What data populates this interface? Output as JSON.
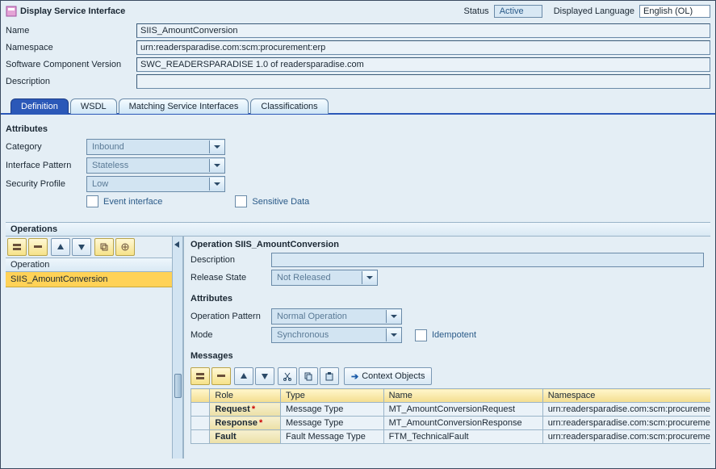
{
  "header": {
    "title": "Display Service Interface",
    "status_label": "Status",
    "status_value": "Active",
    "lang_label": "Displayed Language",
    "lang_value": "English (OL)"
  },
  "topfields": {
    "name_label": "Name",
    "name_value": "SIIS_AmountConversion",
    "namespace_label": "Namespace",
    "namespace_value": "urn:readersparadise.com:scm:procurement:erp",
    "swcv_label": "Software Component Version",
    "swcv_value": "SWC_READERSPARADISE 1.0 of readersparadise.com",
    "desc_label": "Description",
    "desc_value": ""
  },
  "tabs": {
    "definition": "Definition",
    "wsdl": "WSDL",
    "matching": "Matching Service Interfaces",
    "classifications": "Classifications"
  },
  "attributes": {
    "section": "Attributes",
    "category_label": "Category",
    "category_value": "Inbound",
    "pattern_label": "Interface Pattern",
    "pattern_value": "Stateless",
    "security_label": "Security Profile",
    "security_value": "Low",
    "event_interface": "Event interface",
    "sensitive_data": "Sensitive Data"
  },
  "operations": {
    "title": "Operations",
    "col_header": "Operation",
    "items": [
      "SIIS_AmountConversion"
    ]
  },
  "opdetail": {
    "title_prefix": "Operation ",
    "name": "SIIS_AmountConversion",
    "desc_label": "Description",
    "desc_value": "",
    "release_label": "Release State",
    "release_value": "Not Released",
    "attributes_section": "Attributes",
    "op_pattern_label": "Operation Pattern",
    "op_pattern_value": "Normal Operation",
    "mode_label": "Mode",
    "mode_value": "Synchronous",
    "idempotent_label": "Idempotent",
    "messages_section": "Messages",
    "context_objects": "Context Objects",
    "table": {
      "headers": {
        "role": "Role",
        "type": "Type",
        "name": "Name",
        "namespace": "Namespace"
      },
      "rows": [
        {
          "role": "Request",
          "star": true,
          "type": "Message Type",
          "name": "MT_AmountConversionRequest",
          "namespace": "urn:readersparadise.com:scm:procurement"
        },
        {
          "role": "Response",
          "star": true,
          "type": "Message Type",
          "name": "MT_AmountConversionResponse",
          "namespace": "urn:readersparadise.com:scm:procurement"
        },
        {
          "role": "Fault",
          "star": false,
          "type": "Fault Message Type",
          "name": "FTM_TechnicalFault",
          "namespace": "urn:readersparadise.com:scm:procurement"
        }
      ]
    }
  }
}
